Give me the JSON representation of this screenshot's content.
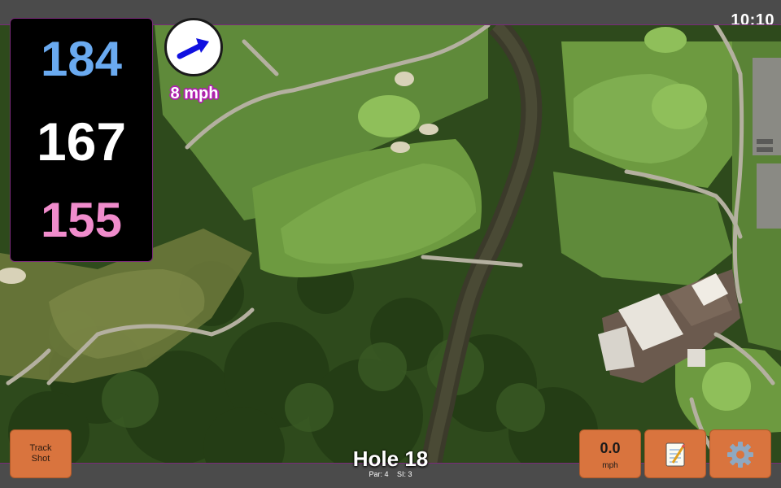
{
  "status_bar": {
    "time": "10:10"
  },
  "yardages": {
    "back": "184",
    "middle": "167",
    "front": "155"
  },
  "wind": {
    "label": "8 mph",
    "icon": "arrow-icon",
    "color": "#1010e0"
  },
  "hole": {
    "title": "Hole 18",
    "par": "Par: 4",
    "si": "SI: 3"
  },
  "buttons": {
    "track_shot": "Track\nShot",
    "speed_value": "0.0",
    "speed_unit": "mph",
    "notes_icon": "notepad-icon",
    "settings_icon": "gear-icon"
  },
  "colors": {
    "back": "#6aaaf0",
    "middle": "#ffffff",
    "front": "#f08ccc",
    "button": "#d9743e",
    "border_accent": "#7a2a7a"
  }
}
